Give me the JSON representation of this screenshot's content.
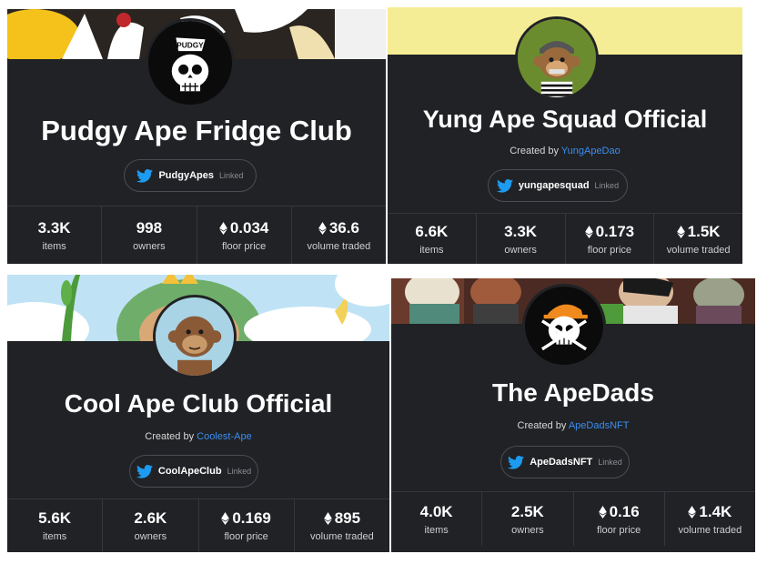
{
  "cards": [
    {
      "title": "Pudgy Ape Fridge Club",
      "created_prefix": "",
      "creator": "",
      "twitter_handle": "PudgyApes",
      "linked_label": "Linked",
      "stats": [
        {
          "value": "3.3K",
          "label": "items",
          "eth": false
        },
        {
          "value": "998",
          "label": "owners",
          "eth": false
        },
        {
          "value": "0.034",
          "label": "floor price",
          "eth": true
        },
        {
          "value": "36.6",
          "label": "volume traded",
          "eth": true
        }
      ]
    },
    {
      "title": "Yung Ape Squad Official",
      "created_prefix": "Created by",
      "creator": "YungApeDao",
      "twitter_handle": "yungapesquad",
      "linked_label": "Linked",
      "stats": [
        {
          "value": "6.6K",
          "label": "items",
          "eth": false
        },
        {
          "value": "3.3K",
          "label": "owners",
          "eth": false
        },
        {
          "value": "0.173",
          "label": "floor price",
          "eth": true
        },
        {
          "value": "1.5K",
          "label": "volume traded",
          "eth": true
        }
      ]
    },
    {
      "title": "Cool Ape Club Official",
      "created_prefix": "Created by",
      "creator": "Coolest-Ape",
      "twitter_handle": "CoolApeClub",
      "linked_label": "Linked",
      "stats": [
        {
          "value": "5.6K",
          "label": "items",
          "eth": false
        },
        {
          "value": "2.6K",
          "label": "owners",
          "eth": false
        },
        {
          "value": "0.169",
          "label": "floor price",
          "eth": true
        },
        {
          "value": "895",
          "label": "volume traded",
          "eth": true
        }
      ]
    },
    {
      "title": "The ApeDads",
      "created_prefix": "Created by",
      "creator": "ApeDadsNFT",
      "twitter_handle": "ApeDadsNFT",
      "linked_label": "Linked",
      "stats": [
        {
          "value": "4.0K",
          "label": "items",
          "eth": false
        },
        {
          "value": "2.5K",
          "label": "owners",
          "eth": false
        },
        {
          "value": "0.16",
          "label": "floor price",
          "eth": true
        },
        {
          "value": "1.4K",
          "label": "volume traded",
          "eth": true
        }
      ]
    }
  ],
  "icons": {
    "twitter": "twitter-bird-icon",
    "currency": "ethereum-icon"
  },
  "colors": {
    "card_bg": "#202225",
    "link": "#3b8ef2",
    "twitter_blue": "#1d9bf0"
  }
}
